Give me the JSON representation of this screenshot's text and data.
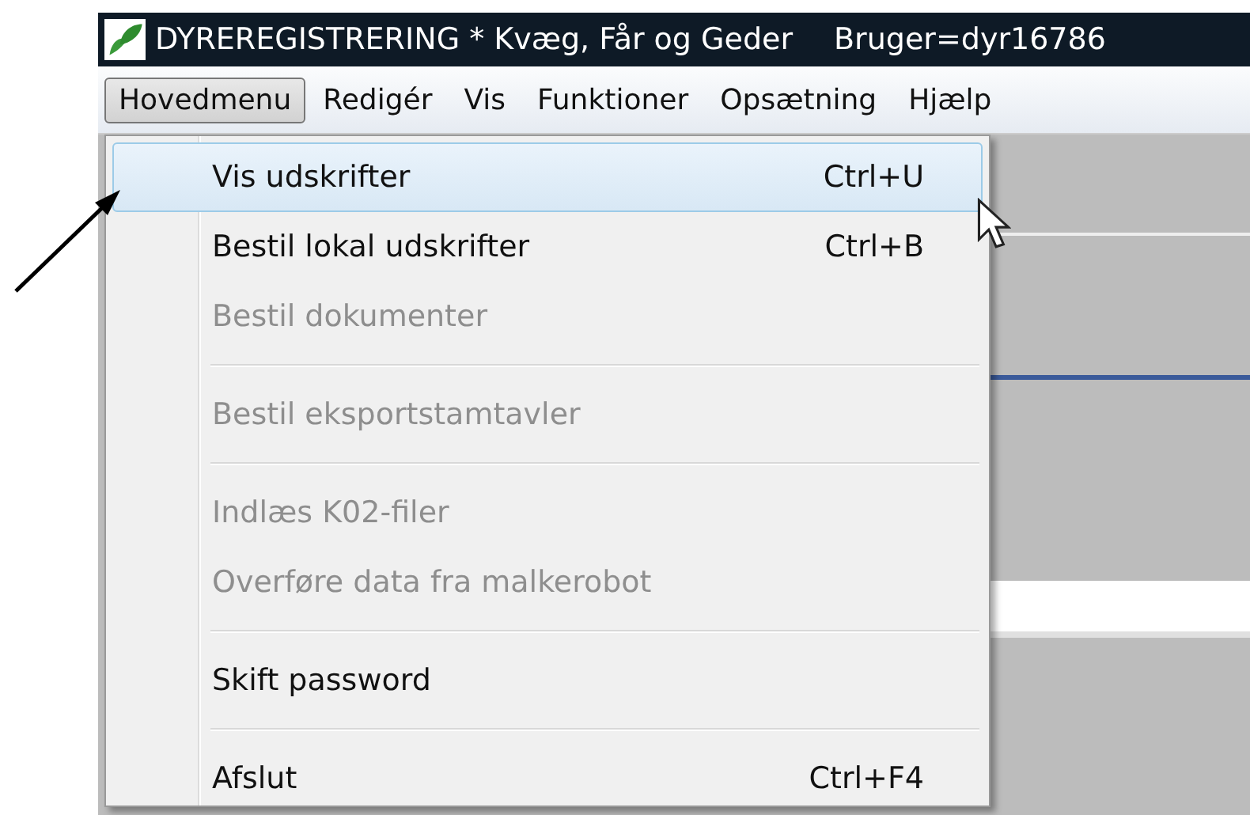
{
  "window": {
    "title": "DYREREGISTRERING * Kvæg, Får og Geder",
    "user": "Bruger=dyr16786"
  },
  "menu_bar": [
    {
      "label": "Hovedmenu",
      "selected": true
    },
    {
      "label": "Redigér",
      "selected": false
    },
    {
      "label": "Vis",
      "selected": false
    },
    {
      "label": "Funktioner",
      "selected": false
    },
    {
      "label": "Opsætning",
      "selected": false
    },
    {
      "label": "Hjælp",
      "selected": false
    }
  ],
  "dropdown": [
    {
      "kind": "item",
      "label": "Vis udskrifter",
      "shortcut": "Ctrl+U",
      "disabled": false,
      "selected": true
    },
    {
      "kind": "item",
      "label": "Bestil lokal udskrifter",
      "shortcut": "Ctrl+B",
      "disabled": false,
      "selected": false
    },
    {
      "kind": "item",
      "label": "Bestil dokumenter",
      "disabled": true,
      "selected": false
    },
    {
      "kind": "separator"
    },
    {
      "kind": "item",
      "label": "Bestil eksportstamtavler",
      "disabled": true,
      "selected": false
    },
    {
      "kind": "separator"
    },
    {
      "kind": "item",
      "label": "Indlæs K02-filer",
      "disabled": true,
      "selected": false
    },
    {
      "kind": "item",
      "label": "Overføre data fra malkerobot",
      "disabled": true,
      "selected": false
    },
    {
      "kind": "separator"
    },
    {
      "kind": "item",
      "label": "Skift password",
      "disabled": false,
      "selected": false
    },
    {
      "kind": "separator"
    },
    {
      "kind": "item",
      "label": "Afslut",
      "shortcut": "Ctrl+F4",
      "disabled": false,
      "selected": false
    }
  ]
}
